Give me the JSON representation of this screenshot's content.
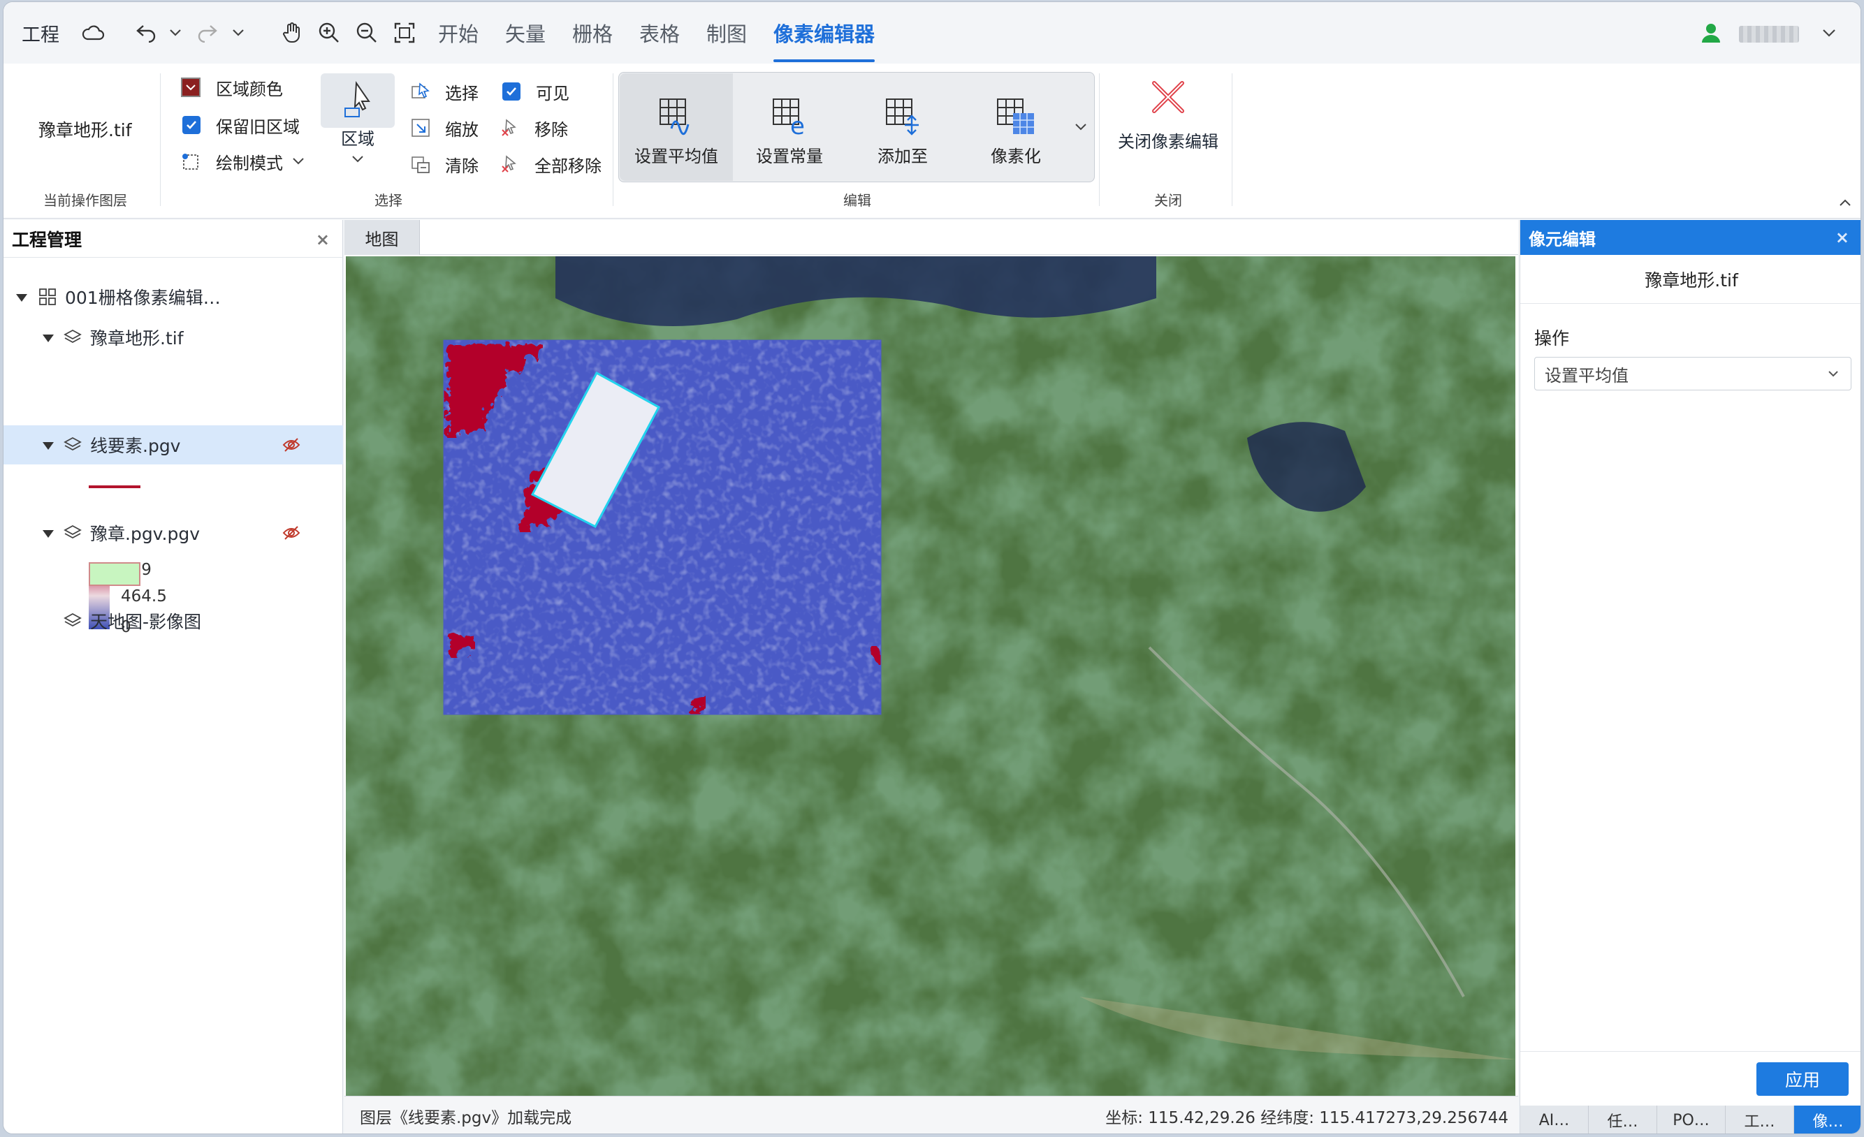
{
  "topbar": {
    "project_label": "工程",
    "tabs": [
      {
        "label": "开始"
      },
      {
        "label": "矢量"
      },
      {
        "label": "栅格"
      },
      {
        "label": "表格"
      },
      {
        "label": "制图"
      },
      {
        "label": "像素编辑器",
        "active": true
      }
    ],
    "accent_color": "#1e6fd9"
  },
  "ribbon": {
    "current_layer": {
      "value": "豫章地形.tif",
      "group_label": "当前操作图层"
    },
    "select_group": {
      "region_color_label": "区域颜色",
      "keep_old_region_label": "保留旧区域",
      "keep_old_region_checked": true,
      "draw_mode_label": "绘制模式",
      "region_button_label": "区域",
      "select_label": "选择",
      "zoom_label": "缩放",
      "clear_label": "清除",
      "visible_label": "可见",
      "visible_checked": true,
      "remove_label": "移除",
      "remove_all_label": "全部移除",
      "group_label": "选择"
    },
    "edit_group": {
      "buttons": [
        {
          "label": "设置平均值",
          "icon": "grid-average-icon"
        },
        {
          "label": "设置常量",
          "icon": "grid-constant-icon"
        },
        {
          "label": "添加至",
          "icon": "grid-add-icon"
        },
        {
          "label": "像素化",
          "icon": "grid-pixelate-icon"
        }
      ],
      "group_label": "编辑"
    },
    "close_group": {
      "button_label": "关闭像素编辑",
      "group_label": "关闭",
      "icon_color": "#e0424a"
    }
  },
  "left_panel": {
    "title": "工程管理",
    "project_name": "001栅格像素编辑…",
    "layers": [
      {
        "name": "豫章地形.tif",
        "legend": {
          "max": "929",
          "mid": "464.5",
          "min": "0"
        }
      },
      {
        "name": "线要素.pgv",
        "selected": true,
        "hidden": true,
        "symbol_color": "#b3142d"
      },
      {
        "name": "豫章.pgv.pgv",
        "hidden": true,
        "symbol_fill": "#c8f5c0",
        "symbol_stroke": "#d08a8a"
      },
      {
        "name": "天地图-影像图"
      }
    ]
  },
  "map": {
    "tab_label": "地图",
    "status_message": "图层《线要素.pgv》加载完成",
    "coordinates": "坐标: 115.42,29.26 经纬度: 115.417273,29.256744",
    "selection_color": "#22d3ee",
    "raster_color_low": "#4a5ac6",
    "raster_color_high": "#b3002a"
  },
  "right_panel": {
    "title": "像元编辑",
    "layer_name": "豫章地形.tif",
    "operation_label": "操作",
    "operation_value": "设置平均值",
    "apply_label": "应用",
    "bottom_tabs": [
      {
        "label": "AI…"
      },
      {
        "label": "任…"
      },
      {
        "label": "PO…"
      },
      {
        "label": "工…"
      },
      {
        "label": "像…",
        "active": true
      }
    ]
  }
}
